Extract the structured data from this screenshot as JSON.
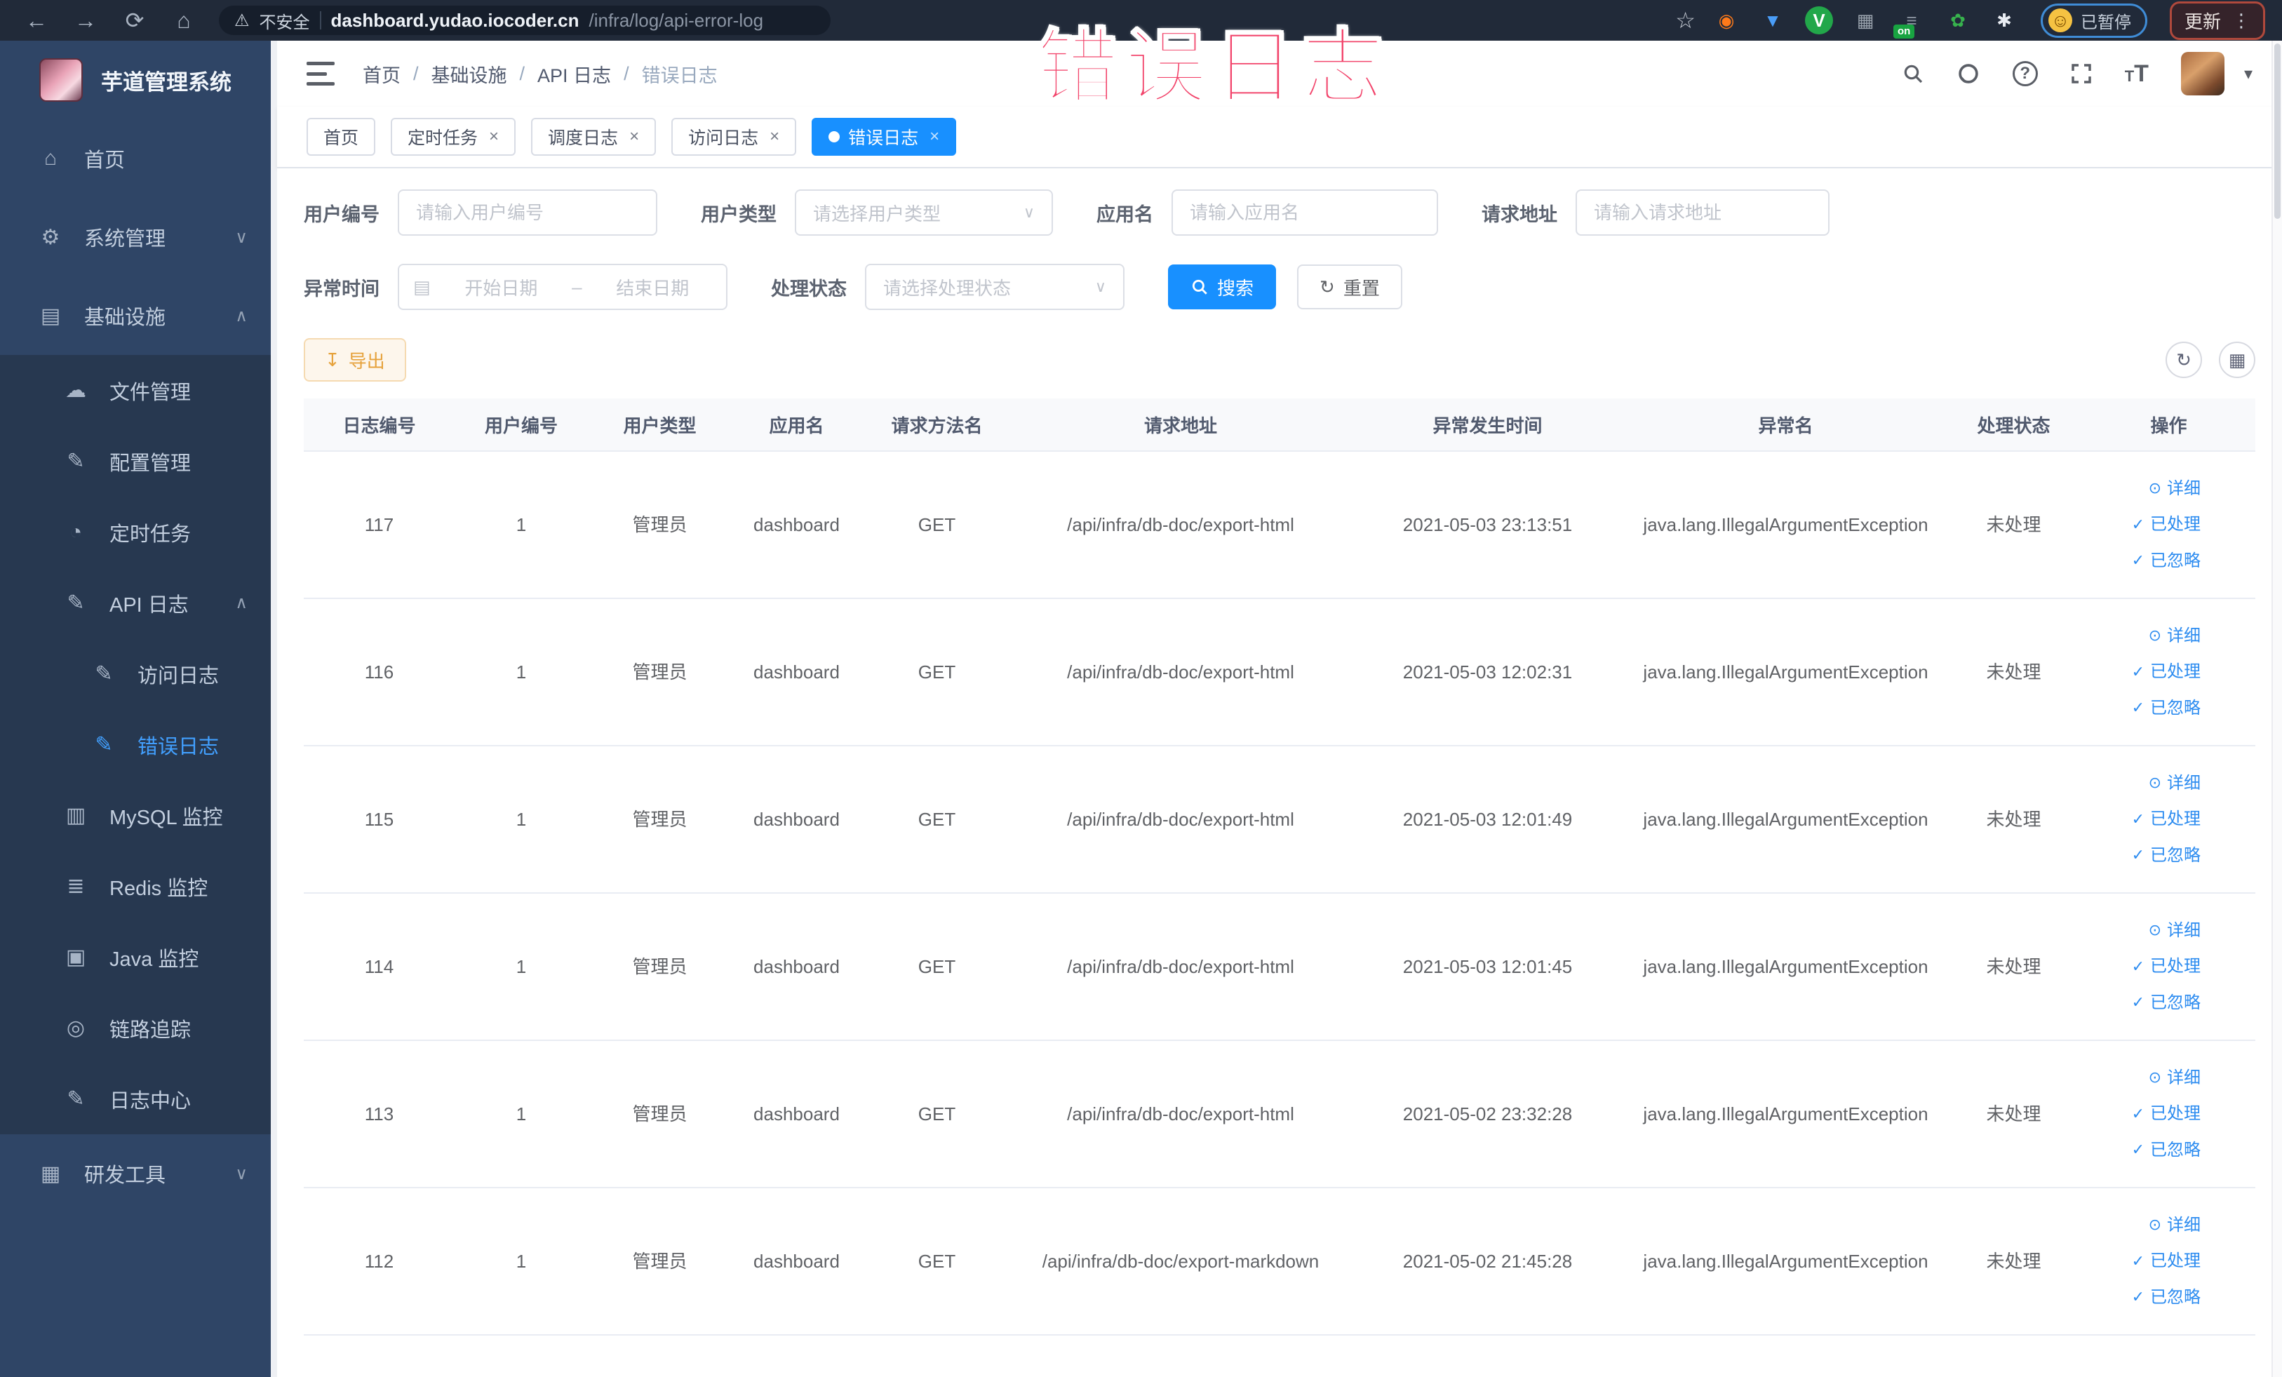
{
  "browser": {
    "back_glyph": "←",
    "forward_glyph": "→",
    "reload_glyph": "⟳",
    "home_glyph": "⌂",
    "warning_glyph": "⚠",
    "security_label": "不安全",
    "url_host": "dashboard.yudao.iocoder.cn",
    "url_path": "/infra/log/api-error-log",
    "bookmark_glyph": "☆",
    "extensions": [
      {
        "name": "ext-orange-icon",
        "glyph": "◉",
        "color": "#ff7a1a",
        "bg": "transparent",
        "badge": ""
      },
      {
        "name": "ext-shield-icon",
        "glyph": "▼",
        "color": "#4a9df8",
        "bg": "transparent",
        "badge": ""
      },
      {
        "name": "ext-v-green-icon",
        "glyph": "V",
        "color": "#ffffff",
        "bg": "#22a74a",
        "badge": ""
      },
      {
        "name": "ext-grid-icon",
        "glyph": "▦",
        "color": "#9aa3ad",
        "bg": "transparent",
        "badge": ""
      },
      {
        "name": "ext-switch-icon",
        "glyph": "≡",
        "color": "#8a93a0",
        "bg": "transparent",
        "badge": "on"
      },
      {
        "name": "ext-plant-icon",
        "glyph": "✿",
        "color": "#37b24d",
        "bg": "transparent",
        "badge": ""
      },
      {
        "name": "ext-puzzle-icon",
        "glyph": "✱",
        "color": "#e8ecf2",
        "bg": "transparent",
        "badge": ""
      }
    ],
    "profile_face_glyph": "☺",
    "profile_badge": "已暂停",
    "update_button": "更新",
    "kebab_glyph": "⋮"
  },
  "watermark": "错误日志",
  "sidebar": {
    "logo_title": "芋道管理系统",
    "items": [
      {
        "icon": "home-icon",
        "glyph": "⌂",
        "label": "首页",
        "chev": "",
        "top": true
      },
      {
        "icon": "gear-icon",
        "glyph": "⚙",
        "label": "系统管理",
        "chev": "∨",
        "top": true
      },
      {
        "icon": "infrastructure-icon",
        "glyph": "▤",
        "label": "基础设施",
        "chev": "∧",
        "top": true
      },
      {
        "icon": "file-manage-icon",
        "glyph": "☁",
        "label": "文件管理",
        "sub": true
      },
      {
        "icon": "config-manage-icon",
        "glyph": "✎",
        "label": "配置管理",
        "sub": true
      },
      {
        "icon": "timer-task-icon",
        "glyph": "◔",
        "label": "定时任务",
        "sub": true
      },
      {
        "icon": "api-log-icon",
        "glyph": "✎",
        "label": "API 日志",
        "chev": "∧",
        "sub": true
      },
      {
        "icon": "access-log-icon",
        "glyph": "✎",
        "label": "访问日志",
        "sub": true,
        "child": true
      },
      {
        "icon": "error-log-icon",
        "glyph": "✎",
        "label": "错误日志",
        "sub": true,
        "child": true,
        "active": true
      },
      {
        "icon": "mysql-monitor-icon",
        "glyph": "▥",
        "label": "MySQL 监控",
        "sub": true
      },
      {
        "icon": "redis-monitor-icon",
        "glyph": "≣",
        "label": "Redis 监控",
        "sub": true
      },
      {
        "icon": "java-monitor-icon",
        "glyph": "▣",
        "label": "Java 监控",
        "sub": true
      },
      {
        "icon": "trace-icon",
        "glyph": "◎",
        "label": "链路追踪",
        "sub": true
      },
      {
        "icon": "log-center-icon",
        "glyph": "✎",
        "label": "日志中心",
        "sub": true
      },
      {
        "icon": "devtools-icon",
        "glyph": "▦",
        "label": "研发工具",
        "chev": "∨",
        "top": true
      }
    ]
  },
  "header": {
    "breadcrumb": [
      "首页",
      "基础设施",
      "API 日志",
      "错误日志"
    ],
    "breadcrumb_separator": "/",
    "help_glyph": "?",
    "fontsize_big": "T",
    "fontsize_small": "T",
    "caret_glyph": "▾"
  },
  "tabs": [
    {
      "label": "首页"
    },
    {
      "label": "定时任务",
      "closable": true
    },
    {
      "label": "调度日志",
      "closable": true
    },
    {
      "label": "访问日志",
      "closable": true
    },
    {
      "label": "错误日志",
      "closable": true,
      "active": true
    }
  ],
  "ui": {
    "close_glyph": "×",
    "eye_glyph": "⊙",
    "check_glyph": "✓",
    "refresh_glyph": "↻",
    "columns_glyph": "▦",
    "export_glyph": "↧",
    "calendar_glyph": "▤",
    "select_caret": "∨"
  },
  "filters": {
    "user_id": {
      "label": "用户编号",
      "placeholder": "请输入用户编号"
    },
    "user_type": {
      "label": "用户类型",
      "placeholder": "请选择用户类型"
    },
    "app_name": {
      "label": "应用名",
      "placeholder": "请输入应用名"
    },
    "request_url": {
      "label": "请求地址",
      "placeholder": "请输入请求地址"
    },
    "exception_time": {
      "label": "异常时间",
      "start_placeholder": "开始日期",
      "separator": "–",
      "end_placeholder": "结束日期"
    },
    "process_status": {
      "label": "处理状态",
      "placeholder": "请选择处理状态"
    },
    "search_label": "搜索",
    "reset_label": "重置"
  },
  "toolbar": {
    "export_label": "导出"
  },
  "table": {
    "columns": [
      "日志编号",
      "用户编号",
      "用户类型",
      "应用名",
      "请求方法名",
      "请求地址",
      "异常发生时间",
      "异常名",
      "处理状态",
      "操作"
    ],
    "action_labels": {
      "detail": "详细",
      "processed": "已处理",
      "ignored": "已忽略"
    },
    "rows": [
      {
        "id": "117",
        "user_id": "1",
        "user_type": "管理员",
        "app": "dashboard",
        "method": "GET",
        "url": "/api/infra/db-doc/export-html",
        "time": "2021-05-03 23:13:51",
        "exception": "java.lang.IllegalArgumentException",
        "status": "未处理"
      },
      {
        "id": "116",
        "user_id": "1",
        "user_type": "管理员",
        "app": "dashboard",
        "method": "GET",
        "url": "/api/infra/db-doc/export-html",
        "time": "2021-05-03 12:02:31",
        "exception": "java.lang.IllegalArgumentException",
        "status": "未处理"
      },
      {
        "id": "115",
        "user_id": "1",
        "user_type": "管理员",
        "app": "dashboard",
        "method": "GET",
        "url": "/api/infra/db-doc/export-html",
        "time": "2021-05-03 12:01:49",
        "exception": "java.lang.IllegalArgumentException",
        "status": "未处理"
      },
      {
        "id": "114",
        "user_id": "1",
        "user_type": "管理员",
        "app": "dashboard",
        "method": "GET",
        "url": "/api/infra/db-doc/export-html",
        "time": "2021-05-03 12:01:45",
        "exception": "java.lang.IllegalArgumentException",
        "status": "未处理"
      },
      {
        "id": "113",
        "user_id": "1",
        "user_type": "管理员",
        "app": "dashboard",
        "method": "GET",
        "url": "/api/infra/db-doc/export-html",
        "time": "2021-05-02 23:32:28",
        "exception": "java.lang.IllegalArgumentException",
        "status": "未处理"
      },
      {
        "id": "112",
        "user_id": "1",
        "user_type": "管理员",
        "app": "dashboard",
        "method": "GET",
        "url": "/api/infra/db-doc/export-markdown",
        "time": "2021-05-02 21:45:28",
        "exception": "java.lang.IllegalArgumentException",
        "status": "未处理"
      }
    ]
  },
  "colors": {
    "primary": "#1890ff",
    "link": "#2d8cf0",
    "sidebar_active": "#42a0ff",
    "warning_button": "#e6a23c",
    "watermark": "#f2436a"
  }
}
